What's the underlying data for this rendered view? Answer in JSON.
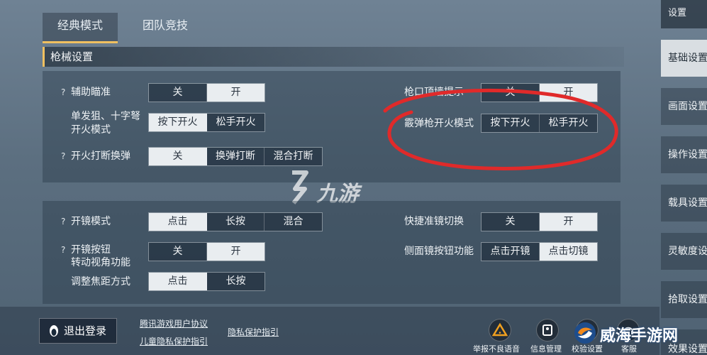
{
  "tabs": [
    "经典模式",
    "团队竞技"
  ],
  "section_title": "枪械设置",
  "settings1": {
    "aim_assist": {
      "label": "辅助瞄准",
      "options": [
        "关",
        "开"
      ]
    },
    "single_shot": {
      "label_line1": "单发狙、十字弩",
      "label_line2": "开火模式",
      "options": [
        "按下开火",
        "松手开火"
      ]
    },
    "fire_interrupt": {
      "label": "开火打断换弹",
      "options": [
        "关",
        "换弹打断",
        "混合打断"
      ]
    },
    "wall_hint": {
      "label": "枪口顶墙提示",
      "options": [
        "关",
        "开"
      ]
    },
    "shotgun_fire": {
      "label": "霰弹枪开火模式",
      "options": [
        "按下开火",
        "松手开火"
      ]
    }
  },
  "settings2": {
    "scope_mode": {
      "label": "开镜模式",
      "options": [
        "点击",
        "长按",
        "混合"
      ]
    },
    "scope_button": {
      "label_line1": "开镜按钮",
      "label_line2": "转动视角功能",
      "options": [
        "关",
        "开"
      ]
    },
    "focus_adjust": {
      "label": "调整焦距方式",
      "options": [
        "点击",
        "长按"
      ]
    },
    "quick_scope_switch": {
      "label": "快捷准镜切换",
      "options": [
        "关",
        "开"
      ]
    },
    "side_scope_button": {
      "label": "侧面镜按钮功能",
      "options": [
        "点击开镜",
        "点击切镜"
      ]
    }
  },
  "help_icon": "?",
  "sidebar": {
    "title": "设置",
    "items": [
      "基础设置",
      "画面设置",
      "操作设置",
      "载具设置",
      "灵敏度设置",
      "拾取设置",
      "效果设置"
    ]
  },
  "bottom": {
    "logout": "退出登录",
    "links": [
      "腾讯游戏用户协议",
      "儿童隐私保护指引",
      "隐私保护指引"
    ],
    "buttons": [
      "举报不良语音",
      "信息管理",
      "校验设置",
      "客服"
    ]
  },
  "watermarks": {
    "center": "九游",
    "corner": "威海手游网"
  },
  "colors": {
    "accent": "#f0c060",
    "annotation": "#e02a2a"
  }
}
